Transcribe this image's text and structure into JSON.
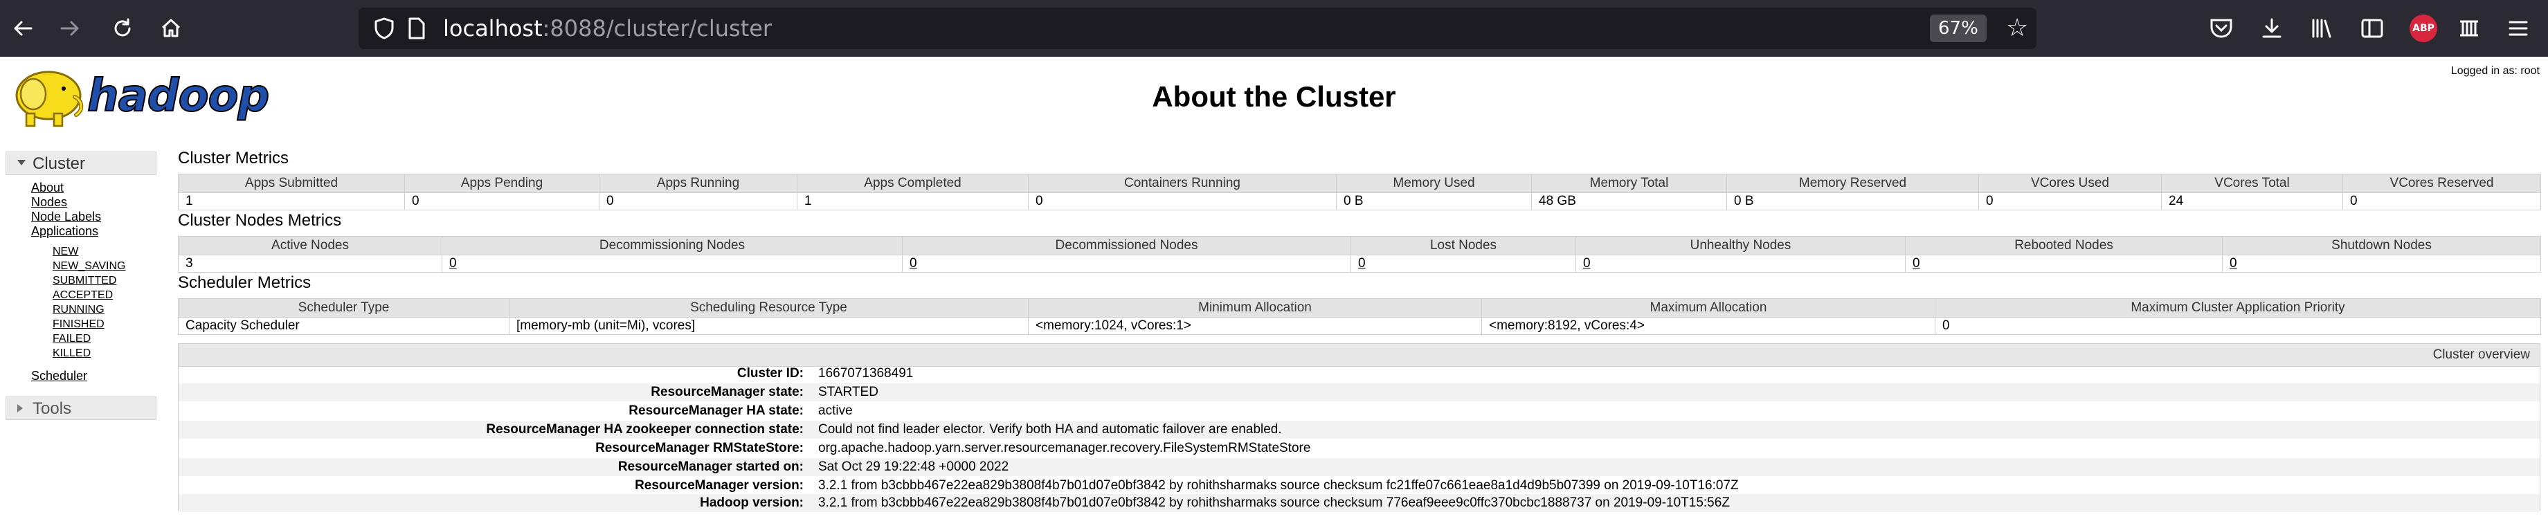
{
  "browser": {
    "url_host": "localhost",
    "url_rest": ":8088/cluster/cluster",
    "zoom": "67%"
  },
  "page": {
    "title": "About the Cluster",
    "logged_in": "Logged in as: root"
  },
  "nav": {
    "cluster_label": "Cluster",
    "links": [
      "About",
      "Nodes",
      "Node Labels",
      "Applications"
    ],
    "app_states": [
      "NEW",
      "NEW_SAVING",
      "SUBMITTED",
      "ACCEPTED",
      "RUNNING",
      "FINISHED",
      "FAILED",
      "KILLED"
    ],
    "scheduler": "Scheduler",
    "tools_label": "Tools"
  },
  "cluster_metrics": {
    "title": "Cluster Metrics",
    "headers": [
      "Apps Submitted",
      "Apps Pending",
      "Apps Running",
      "Apps Completed",
      "Containers Running",
      "Memory Used",
      "Memory Total",
      "Memory Reserved",
      "VCores Used",
      "VCores Total",
      "VCores Reserved"
    ],
    "values": [
      "1",
      "0",
      "0",
      "1",
      "0",
      "0 B",
      "48 GB",
      "0 B",
      "0",
      "24",
      "0"
    ]
  },
  "nodes_metrics": {
    "title": "Cluster Nodes Metrics",
    "headers": [
      "Active Nodes",
      "Decommissioning Nodes",
      "Decommissioned Nodes",
      "Lost Nodes",
      "Unhealthy Nodes",
      "Rebooted Nodes",
      "Shutdown Nodes"
    ],
    "values": [
      "3",
      "0",
      "0",
      "0",
      "0",
      "0",
      "0"
    ]
  },
  "scheduler_metrics": {
    "title": "Scheduler Metrics",
    "headers": [
      "Scheduler Type",
      "Scheduling Resource Type",
      "Minimum Allocation",
      "Maximum Allocation",
      "Maximum Cluster Application Priority"
    ],
    "values": [
      "Capacity Scheduler",
      "[memory-mb (unit=Mi), vcores]",
      "<memory:1024, vCores:1>",
      "<memory:8192, vCores:4>",
      "0"
    ]
  },
  "overview": {
    "title": "Cluster overview",
    "rows": [
      {
        "key": "Cluster ID:",
        "value": "1667071368491"
      },
      {
        "key": "ResourceManager state:",
        "value": "STARTED"
      },
      {
        "key": "ResourceManager HA state:",
        "value": "active"
      },
      {
        "key": "ResourceManager HA zookeeper connection state:",
        "value": "Could not find leader elector. Verify both HA and automatic failover are enabled."
      },
      {
        "key": "ResourceManager RMStateStore:",
        "value": "org.apache.hadoop.yarn.server.resourcemanager.recovery.FileSystemRMStateStore"
      },
      {
        "key": "ResourceManager started on:",
        "value": "Sat Oct 29 19:22:48 +0000 2022"
      },
      {
        "key": "ResourceManager version:",
        "value": "3.2.1 from b3cbbb467e22ea829b3808f4b7b01d07e0bf3842 by rohithsharmaks source checksum fc21ffe07c661eae8a1d4d9b5b07399 on 2019-09-10T16:07Z"
      },
      {
        "key": "Hadoop version:",
        "value": "3.2.1 from b3cbbb467e22ea829b3808f4b7b01d07e0bf3842 by rohithsharmaks source checksum 776eaf9eee9c0ffc370bcbc1888737 on 2019-09-10T15:56Z"
      }
    ]
  }
}
